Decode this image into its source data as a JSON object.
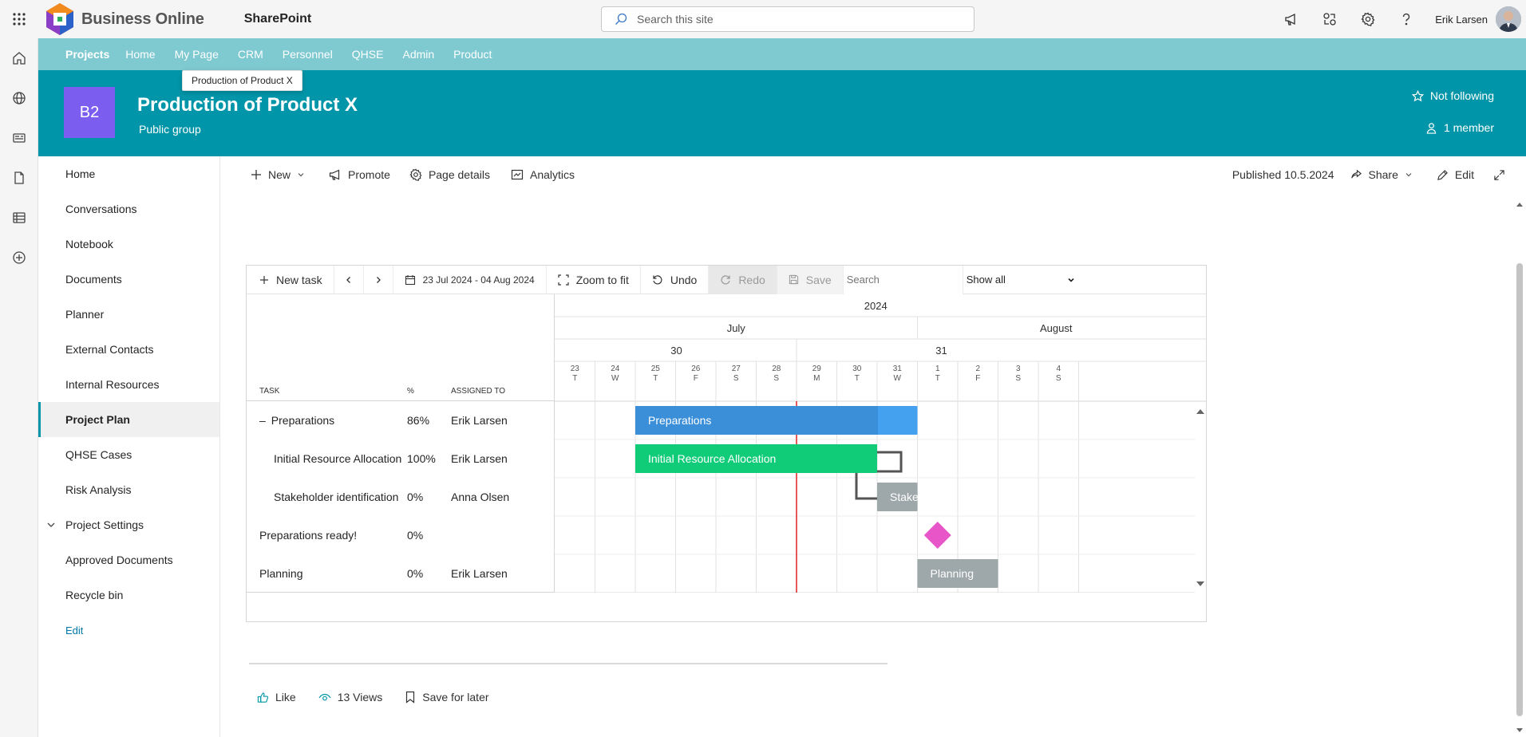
{
  "suite": {
    "brand": "Business Online",
    "app": "SharePoint",
    "search_placeholder": "Search this site",
    "user": "Erik Larsen"
  },
  "hubnav": {
    "items": [
      "Projects",
      "Home",
      "My Page",
      "CRM",
      "Personnel",
      "QHSE",
      "Admin",
      "Product"
    ]
  },
  "tooltip": "Production of Product X",
  "site": {
    "logo_text": "B2",
    "title": "Production of Product X",
    "subtitle": "Public group",
    "follow_label": "Not following",
    "members_label": "1 member",
    "logo_color": "#7b5ef0",
    "header_color": "#0095a8"
  },
  "leftnav": {
    "items": [
      "Home",
      "Conversations",
      "Notebook",
      "Documents",
      "Planner",
      "External Contacts",
      "Internal Resources",
      "Project Plan",
      "QHSE Cases",
      "Risk Analysis",
      "Project Settings",
      "Approved Documents",
      "Recycle bin",
      "Edit"
    ],
    "active": "Project Plan"
  },
  "cmdbar": {
    "new": "New",
    "promote": "Promote",
    "page_details": "Page details",
    "analytics": "Analytics",
    "published": "Published 10.5.2024",
    "share": "Share",
    "edit": "Edit"
  },
  "gantt": {
    "toolbar": {
      "new_task": "New task",
      "date_range": "23 Jul 2024 - 04 Aug 2024",
      "zoom": "Zoom to fit",
      "undo": "Undo",
      "redo": "Redo",
      "save": "Save",
      "search_placeholder": "Search",
      "filter": "Show all"
    },
    "columns": [
      "TASK",
      "%",
      "ASSIGNED TO"
    ],
    "year": "2024",
    "months": [
      "July",
      "August"
    ],
    "weeks": [
      "30",
      "31"
    ],
    "days": [
      {
        "d": "23",
        "w": "T"
      },
      {
        "d": "24",
        "w": "W"
      },
      {
        "d": "25",
        "w": "T"
      },
      {
        "d": "26",
        "w": "F"
      },
      {
        "d": "27",
        "w": "S"
      },
      {
        "d": "28",
        "w": "S"
      },
      {
        "d": "29",
        "w": "M"
      },
      {
        "d": "30",
        "w": "T"
      },
      {
        "d": "31",
        "w": "W"
      },
      {
        "d": "1",
        "w": "T"
      },
      {
        "d": "2",
        "w": "F"
      },
      {
        "d": "3",
        "w": "S"
      },
      {
        "d": "4",
        "w": "S"
      }
    ],
    "tasks": [
      {
        "name": "Preparations",
        "collapse": "–",
        "pct": "86%",
        "assigned": "Erik Larsen",
        "start": 2,
        "end": 9,
        "progress": 0.86,
        "kind": "summary",
        "bar_label": "Preparations"
      },
      {
        "name": "Initial Resource Allocation",
        "pct": "100%",
        "assigned": "Erik Larsen",
        "start": 2,
        "end": 8,
        "progress": 1.0,
        "kind": "task",
        "bar_label": "Initial Resource Allocation"
      },
      {
        "name": "Stakeholder identification",
        "pct": "0%",
        "assigned": "Anna Olsen",
        "start": 8,
        "end": 9,
        "progress": 0,
        "kind": "task",
        "bar_label": "Stakeho"
      },
      {
        "name": "Preparations ready!",
        "pct": "0%",
        "assigned": "",
        "start": 9.5,
        "end": 9.5,
        "progress": 0,
        "kind": "milestone",
        "bar_label": ""
      },
      {
        "name": "Planning",
        "pct": "0%",
        "assigned": "Erik Larsen",
        "start": 9,
        "end": 11,
        "progress": 0,
        "kind": "task",
        "bar_label": "Planning"
      }
    ],
    "today_index": 6,
    "colors": {
      "summary": "#3b8fd9",
      "summary_light": "#43a1ef",
      "done": "#10cc78",
      "pending": "#9ea7aa",
      "milestone": "#e855c8",
      "today": "#e02020"
    }
  },
  "footer": {
    "like": "Like",
    "views": "13 Views",
    "save_for_later": "Save for later"
  }
}
